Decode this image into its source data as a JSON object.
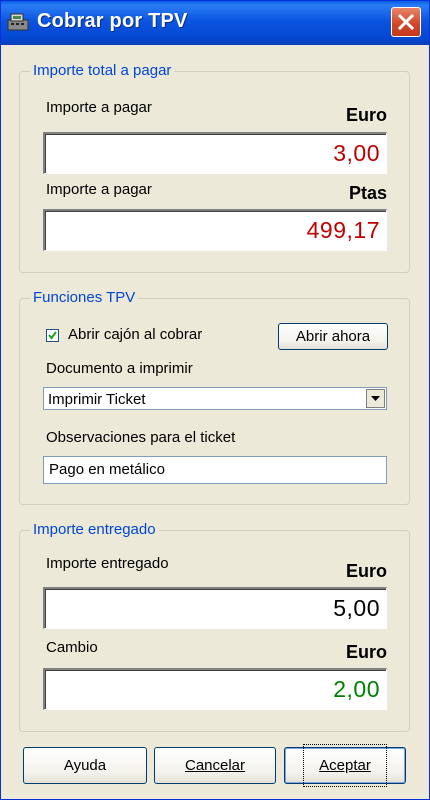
{
  "window": {
    "title": "Cobrar por TPV"
  },
  "total_group": {
    "legend": "Importe total a pagar",
    "euro_label": "Importe a pagar",
    "euro_unit": "Euro",
    "euro_value": "3,00",
    "ptas_label": "Importe a pagar",
    "ptas_unit": "Ptas",
    "ptas_value": "499,17"
  },
  "tpv_group": {
    "legend": "Funciones TPV",
    "checkbox_label": "Abrir cajón al cobrar",
    "checkbox_checked": true,
    "open_now_button": "Abrir ahora",
    "document_label": "Documento a imprimir",
    "document_selected": "Imprimir Ticket",
    "notes_label": "Observaciones para el ticket",
    "notes_value": "Pago en metálico"
  },
  "delivered_group": {
    "legend": "Importe entregado",
    "delivered_label": "Importe entregado",
    "delivered_unit": "Euro",
    "delivered_value": "5,00",
    "change_label": "Cambio",
    "change_unit": "Euro",
    "change_value": "2,00"
  },
  "buttons": {
    "help": "Ayuda",
    "cancel": "Cancelar",
    "accept": "Aceptar"
  },
  "colors": {
    "amount_due": "#c00000",
    "delivered": "#000000",
    "change": "#008000",
    "legend": "#0046d5"
  },
  "icons": {
    "app": "cash-register-icon",
    "close": "close-icon",
    "check": "checkmark-icon",
    "dropdown": "chevron-down-icon"
  }
}
